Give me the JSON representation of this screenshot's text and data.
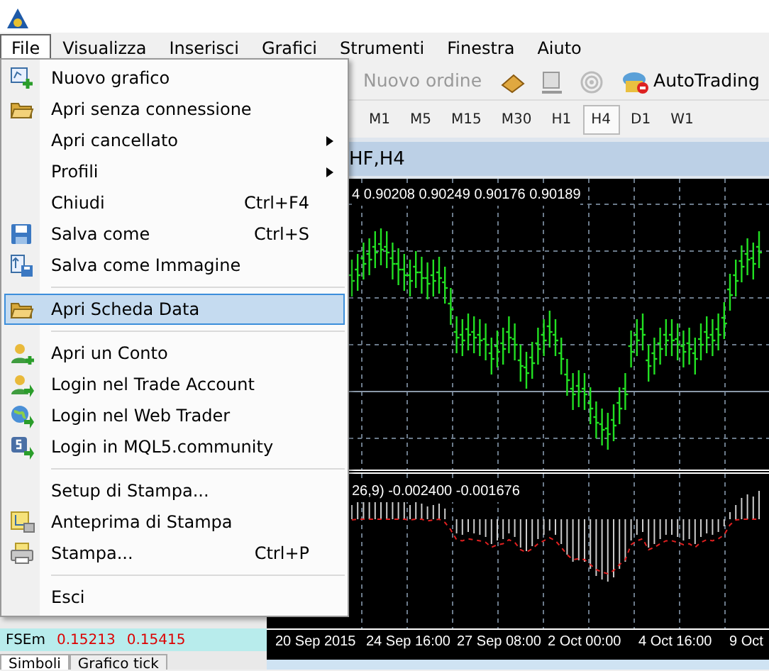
{
  "menu_bar": [
    {
      "label": "File",
      "selected": true
    },
    {
      "label": "Visualizza",
      "selected": false
    },
    {
      "label": "Inserisci",
      "selected": false
    },
    {
      "label": "Grafici",
      "selected": false
    },
    {
      "label": "Strumenti",
      "selected": false
    },
    {
      "label": "Finestra",
      "selected": false
    },
    {
      "label": "Aiuto",
      "selected": false
    }
  ],
  "toolbar": {
    "new_order": {
      "label": "Nuovo ordine",
      "disabled": true
    },
    "autotrading": {
      "label": "AutoTrading"
    }
  },
  "timeframes": [
    {
      "label": "M1",
      "selected": false
    },
    {
      "label": "M5",
      "selected": false
    },
    {
      "label": "M15",
      "selected": false
    },
    {
      "label": "M30",
      "selected": false
    },
    {
      "label": "H1",
      "selected": false
    },
    {
      "label": "H4",
      "selected": true
    },
    {
      "label": "D1",
      "selected": false
    },
    {
      "label": "W1",
      "selected": false
    }
  ],
  "chart_window": {
    "title": "HF,H4",
    "price_info": "4  0.90208 0.90249 0.90176 0.90189",
    "indicator_info": "26,9) -0.002400 -0.001676",
    "time_labels": [
      "20 Sep 2015",
      "24 Sep 16:00",
      "27 Sep 08:00",
      "2 Oct 00:00",
      "4 Oct 16:00",
      "9 Oct"
    ]
  },
  "market_watch": {
    "row": {
      "symbol": "FSEm",
      "bid": "0.15213",
      "ask": "0.15415"
    },
    "tabs": [
      {
        "label": "Simboli",
        "selected": true
      },
      {
        "label": "Grafico tick",
        "selected": false
      }
    ]
  },
  "file_menu": [
    {
      "kind": "item",
      "label": "Nuovo grafico",
      "selected": false
    },
    {
      "kind": "item",
      "label": "Apri senza connessione",
      "selected": false
    },
    {
      "kind": "item",
      "label": "Apri cancellato",
      "submenu": true,
      "selected": false
    },
    {
      "kind": "item",
      "label": "Profili",
      "submenu": true,
      "selected": false
    },
    {
      "kind": "item",
      "label": "Chiudi",
      "shortcut": "Ctrl+F4",
      "selected": false
    },
    {
      "kind": "item",
      "label": "Salva come",
      "shortcut": "Ctrl+S",
      "selected": false
    },
    {
      "kind": "item",
      "label": "Salva come Immagine",
      "selected": false
    },
    {
      "kind": "separator"
    },
    {
      "kind": "item",
      "label": "Apri Scheda Data",
      "selected": true
    },
    {
      "kind": "separator"
    },
    {
      "kind": "item",
      "label": "Apri un Conto",
      "selected": false
    },
    {
      "kind": "item",
      "label": "Login nel Trade Account",
      "selected": false
    },
    {
      "kind": "item",
      "label": "Login nel Web Trader",
      "selected": false
    },
    {
      "kind": "item",
      "label": "Login in MQL5.community",
      "selected": false
    },
    {
      "kind": "separator"
    },
    {
      "kind": "item",
      "label": "Setup di Stampa...",
      "selected": false
    },
    {
      "kind": "item",
      "label": "Anteprima di Stampa",
      "selected": false
    },
    {
      "kind": "item",
      "label": "Stampa...",
      "shortcut": "Ctrl+P",
      "selected": false
    },
    {
      "kind": "separator"
    },
    {
      "kind": "item",
      "label": "Esci",
      "selected": false
    }
  ]
}
